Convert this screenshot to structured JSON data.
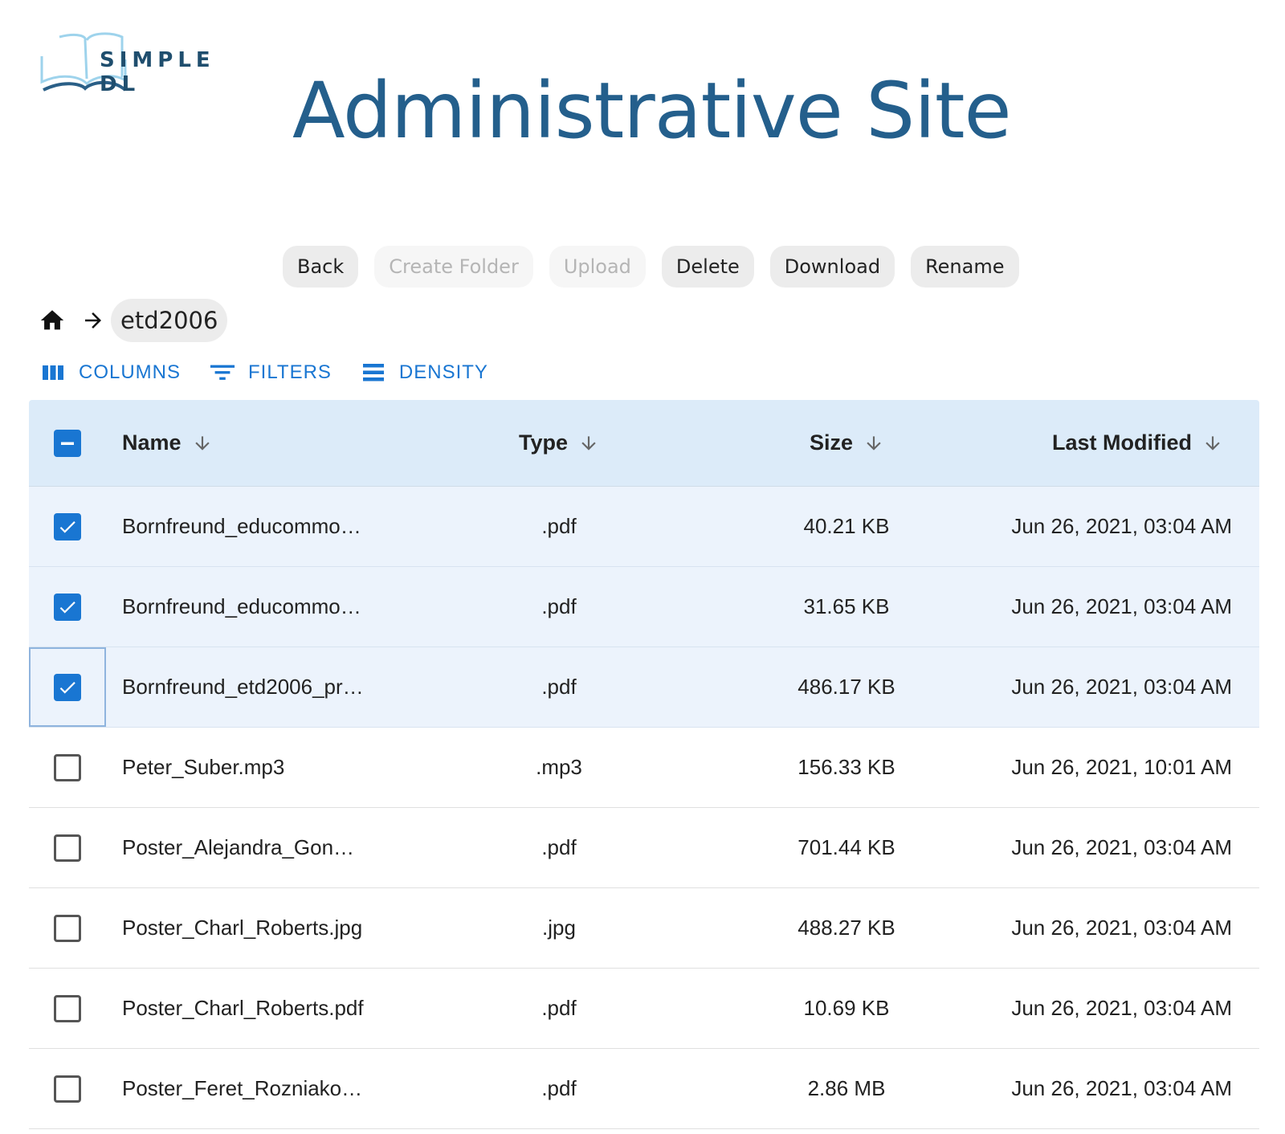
{
  "logo": {
    "text": "SIMPLE DL"
  },
  "title": "Administrative Site",
  "actions": [
    {
      "label": "Back",
      "enabled": true
    },
    {
      "label": "Create Folder",
      "enabled": false
    },
    {
      "label": "Upload",
      "enabled": false
    },
    {
      "label": "Delete",
      "enabled": true
    },
    {
      "label": "Download",
      "enabled": true
    },
    {
      "label": "Rename",
      "enabled": true
    }
  ],
  "breadcrumb": {
    "current": "etd2006"
  },
  "toolbar": {
    "columns": "COLUMNS",
    "filters": "FILTERS",
    "density": "DENSITY"
  },
  "table": {
    "columns": {
      "name": "Name",
      "type": "Type",
      "size": "Size",
      "modified": "Last Modified"
    },
    "rows": [
      {
        "name": "Bornfreund_educommo…",
        "type": ".pdf",
        "size": "40.21 KB",
        "modified": "Jun 26, 2021, 03:04 AM",
        "checked": true
      },
      {
        "name": "Bornfreund_educommo…",
        "type": ".pdf",
        "size": "31.65 KB",
        "modified": "Jun 26, 2021, 03:04 AM",
        "checked": true
      },
      {
        "name": "Bornfreund_etd2006_pr…",
        "type": ".pdf",
        "size": "486.17 KB",
        "modified": "Jun 26, 2021, 03:04 AM",
        "checked": true
      },
      {
        "name": "Peter_Suber.mp3",
        "type": ".mp3",
        "size": "156.33 KB",
        "modified": "Jun 26, 2021, 10:01 AM",
        "checked": false
      },
      {
        "name": "Poster_Alejandra_Gon…",
        "type": ".pdf",
        "size": "701.44 KB",
        "modified": "Jun 26, 2021, 03:04 AM",
        "checked": false
      },
      {
        "name": "Poster_Charl_Roberts.jpg",
        "type": ".jpg",
        "size": "488.27 KB",
        "modified": "Jun 26, 2021, 03:04 AM",
        "checked": false
      },
      {
        "name": "Poster_Charl_Roberts.pdf",
        "type": ".pdf",
        "size": "10.69 KB",
        "modified": "Jun 26, 2021, 03:04 AM",
        "checked": false
      },
      {
        "name": "Poster_Feret_Rozniako…",
        "type": ".pdf",
        "size": "2.86 MB",
        "modified": "Jun 26, 2021, 03:04 AM",
        "checked": false
      }
    ]
  },
  "colors": {
    "accent": "#1976d2",
    "title": "#245f8c",
    "headerBg": "#dcebf9",
    "selectedRowBg": "#ecf3fc"
  }
}
